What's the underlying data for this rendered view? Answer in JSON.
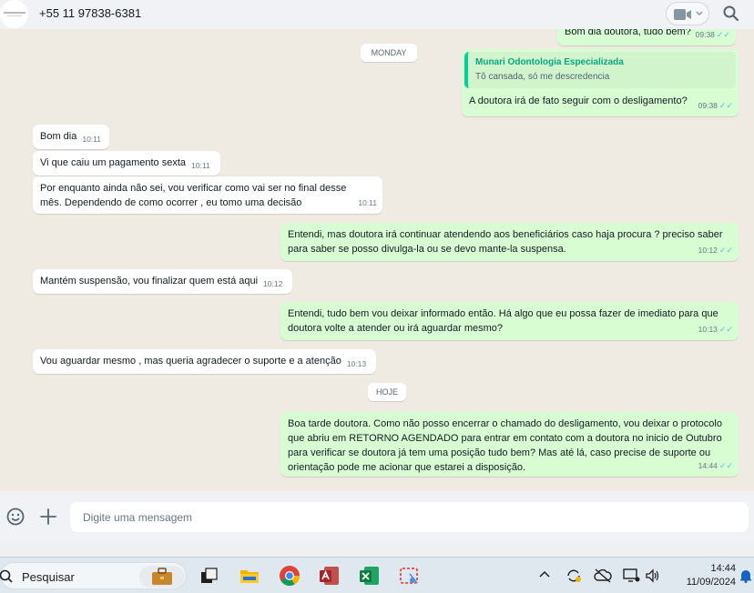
{
  "header": {
    "contact_name": "+55 11 97838-6381"
  },
  "messages": [
    {
      "id": "m0",
      "dir": "out",
      "text": "Bom dia doutora, tudo bem?",
      "time": "09:38",
      "status": "read"
    },
    {
      "id": "sep1",
      "type": "day",
      "label": "MONDAY"
    },
    {
      "id": "m1",
      "dir": "out",
      "quote_author": "Munari Odontologia Especializada",
      "quote_text": "Tô cansada, só me descredencia",
      "text": "A doutora irá de fato seguir com o desligamento?",
      "time": "09:38",
      "status": "read"
    },
    {
      "id": "m2",
      "dir": "in",
      "text": "Bom dia",
      "time": "10:11"
    },
    {
      "id": "m3",
      "dir": "in",
      "text": "Vi que caiu um pagamento sexta",
      "time": "10:11"
    },
    {
      "id": "m4",
      "dir": "in",
      "text": "Por enquanto ainda não sei, vou verificar como vai ser no final desse mês. Dependendo de como ocorrer , eu tomo uma decisão",
      "time": "10:11"
    },
    {
      "id": "m5",
      "dir": "out",
      "text": "Entendi, mas doutora irá continuar atendendo aos beneficiários caso haja procura ? preciso saber para saber se posso divulga-la ou se devo mante-la suspensa.",
      "time": "10:12",
      "status": "read"
    },
    {
      "id": "m6",
      "dir": "in",
      "text": "Mantém suspensão, vou finalizar quem está aqui",
      "time": "10:12"
    },
    {
      "id": "m7",
      "dir": "out",
      "text": "Entendi, tudo bem vou deixar informado então. Há algo que eu possa fazer de imediato para que doutora volte a atender ou irá aguardar mesmo?",
      "time": "10:13",
      "status": "read"
    },
    {
      "id": "m8",
      "dir": "in",
      "text": "Vou aguardar mesmo , mas queria agradecer o suporte e a atenção",
      "time": "10:13"
    },
    {
      "id": "sep2",
      "type": "day",
      "label": "HOJE"
    },
    {
      "id": "m9",
      "dir": "out",
      "text": "Boa tarde doutora. Como não posso encerrar o chamado do desligamento, vou deixar o protocolo que abriu em RETORNO AGENDADO para entrar em contato com a doutora no inicio de Outubro para verificar se doutora já tem uma posição tudo bem? Mas até lá, caso precise de suporte ou orientação pode me acionar que estarei a disposição.",
      "time": "14:44",
      "status": "read"
    }
  ],
  "composer": {
    "placeholder": "Digite uma mensagem"
  },
  "taskbar": {
    "search_label": "Pesquisar",
    "clock_time": "14:44",
    "clock_date": "11/09/2024"
  },
  "colors": {
    "incoming": "#ffffff",
    "outgoing": "#d9fdd3",
    "chat_bg": "#efeae2",
    "read_tick": "#53bdeb",
    "quote_accent": "#06cf9c"
  }
}
